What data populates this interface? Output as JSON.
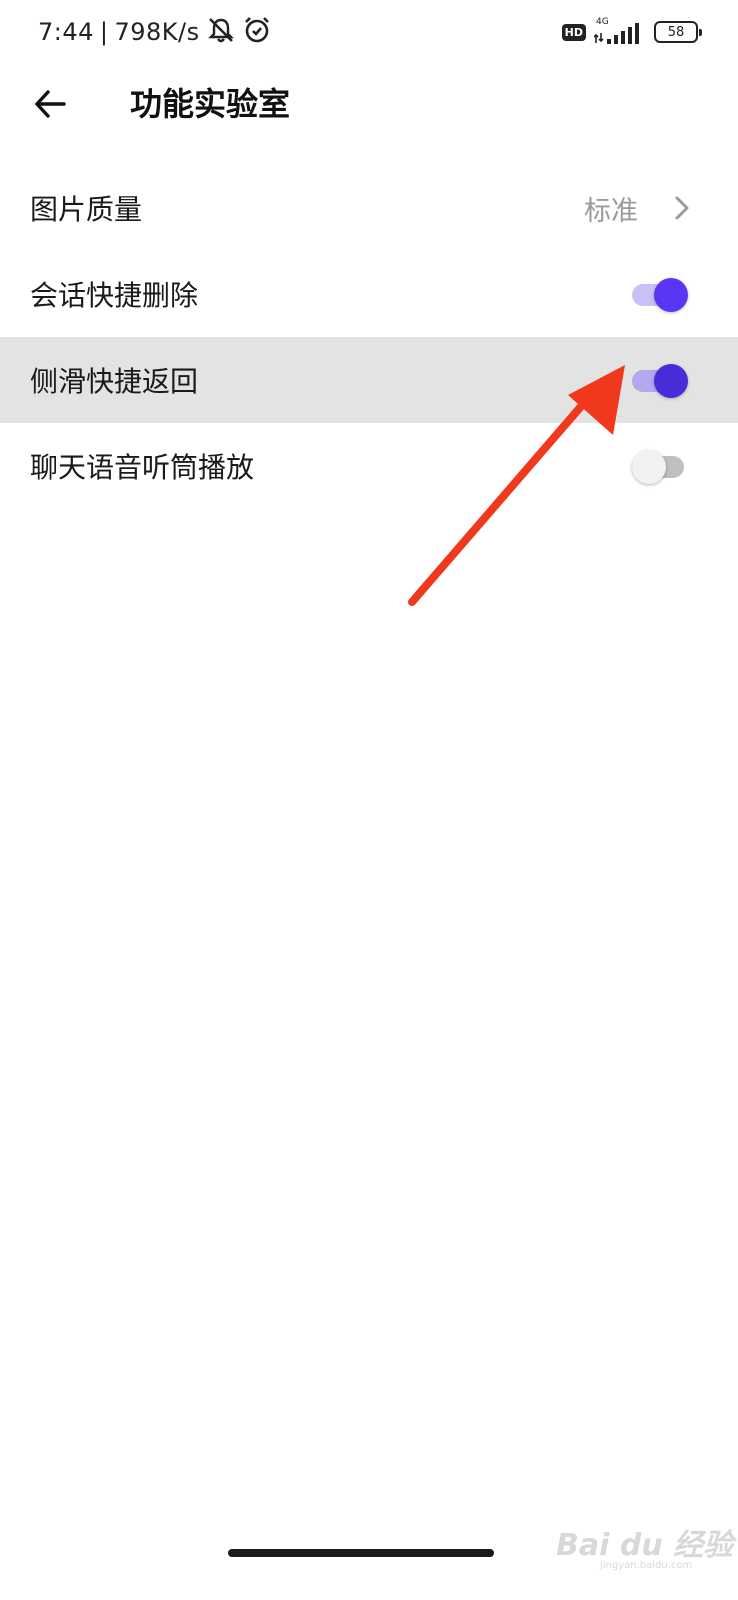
{
  "status_bar": {
    "time": "7:44",
    "separator": "|",
    "speed": "798K/s",
    "hd": "HD",
    "network": "4G",
    "battery": "58",
    "icons": [
      "mute-icon",
      "alarm-icon",
      "signal-icon",
      "battery-icon"
    ]
  },
  "app_bar": {
    "title": "功能实验室",
    "back_icon": "arrow-left-icon"
  },
  "settings": [
    {
      "label": "图片质量",
      "value": "标准",
      "type": "link"
    },
    {
      "label": "会话快捷删除",
      "type": "toggle",
      "enabled": true
    },
    {
      "label": "侧滑快捷返回",
      "type": "toggle",
      "enabled": true,
      "highlighted": true
    },
    {
      "label": "聊天语音听筒播放",
      "type": "toggle",
      "enabled": false
    }
  ],
  "colors": {
    "toggle_on": "#5b35f5",
    "toggle_track_on": "#c9c0f5",
    "highlight_bg": "#e3e3e3",
    "annotation": "#f0391c"
  },
  "watermark": {
    "brand": "Bai du 经验",
    "url": "jingyan.baidu.com"
  }
}
